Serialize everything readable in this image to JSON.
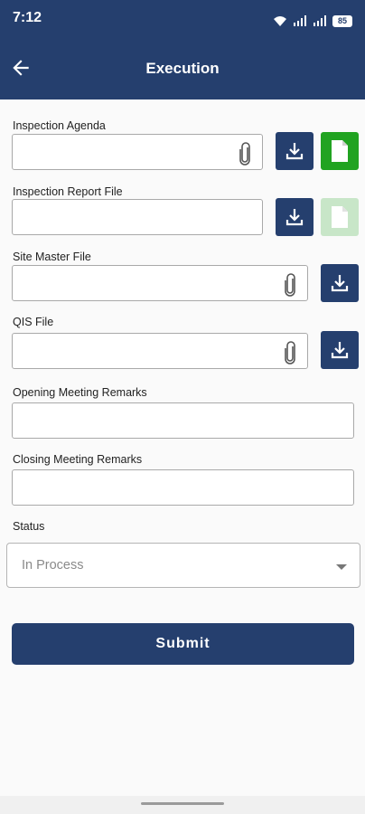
{
  "status_bar": {
    "time": "7:12",
    "battery": "85"
  },
  "header": {
    "title": "Execution"
  },
  "form": {
    "inspection_agenda_label": "Inspection Agenda",
    "inspection_report_label": "Inspection Report File",
    "site_master_label": "Site Master File",
    "qis_label": "QIS File",
    "opening_remarks_label": "Opening Meeting Remarks",
    "closing_remarks_label": "Closing Meeting Remarks",
    "status_label": "Status",
    "status_value": "In Process",
    "submit_label": "Submit"
  },
  "colors": {
    "primary": "#253f6e",
    "green": "#21a321",
    "green_light": "#c8e6c8"
  }
}
